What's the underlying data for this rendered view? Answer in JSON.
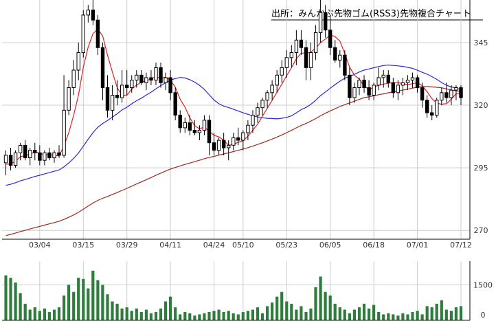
{
  "chart_data": {
    "type": "candlestick",
    "title": "出所：みんかぶ先物ゴム(RSS3)先物複合チャート",
    "x_tick_labels": [
      "03/04",
      "03/15",
      "03/29",
      "04/11",
      "04/24",
      "05/10",
      "05/23",
      "06/05",
      "06/18",
      "07/01",
      "07/12"
    ],
    "price_axis": {
      "ticks": [
        270,
        295,
        320,
        345
      ],
      "ylim": [
        266.5,
        362.0
      ]
    },
    "volume_axis": {
      "ticks": [
        0,
        1500
      ],
      "ylim": [
        0,
        2500
      ]
    },
    "dates": [
      "02/21",
      "02/22",
      "02/26",
      "02/27",
      "02/28",
      "02/29",
      "03/01",
      "03/04",
      "03/05",
      "03/06",
      "03/07",
      "03/08",
      "03/11",
      "03/12",
      "03/13",
      "03/14",
      "03/15",
      "03/18",
      "03/19",
      "03/21",
      "03/22",
      "03/25",
      "03/26",
      "03/27",
      "03/28",
      "03/29",
      "04/01",
      "04/02",
      "04/03",
      "04/04",
      "04/05",
      "04/08",
      "04/09",
      "04/10",
      "04/11",
      "04/12",
      "04/15",
      "04/16",
      "04/17",
      "04/18",
      "04/19",
      "04/22",
      "04/23",
      "04/24",
      "04/25",
      "04/26",
      "05/07",
      "05/08",
      "05/09",
      "05/10",
      "05/13",
      "05/14",
      "05/15",
      "05/16",
      "05/17",
      "05/20",
      "05/21",
      "05/22",
      "05/23",
      "05/24",
      "05/27",
      "05/28",
      "05/29",
      "05/30",
      "05/31",
      "06/03",
      "06/04",
      "06/05",
      "06/06",
      "06/07",
      "06/10",
      "06/11",
      "06/12",
      "06/13",
      "06/14",
      "06/17",
      "06/18",
      "06/19",
      "06/20",
      "06/21",
      "06/24",
      "06/25",
      "06/26",
      "06/27",
      "06/28",
      "07/01",
      "07/02",
      "07/03",
      "07/04",
      "07/05",
      "07/08",
      "07/09",
      "07/10",
      "07/11",
      "07/12"
    ],
    "ohlc": [
      [
        297,
        302,
        292,
        300
      ],
      [
        300,
        303,
        294,
        296
      ],
      [
        296,
        302,
        295,
        301
      ],
      [
        301,
        305,
        298,
        304
      ],
      [
        304,
        306,
        298,
        299
      ],
      [
        299,
        303,
        296,
        302
      ],
      [
        302,
        305,
        298,
        301
      ],
      [
        301,
        304,
        296,
        298
      ],
      [
        298,
        302,
        296,
        301
      ],
      [
        301,
        303,
        298,
        299
      ],
      [
        299,
        302,
        297,
        301
      ],
      [
        301,
        304,
        299,
        300
      ],
      [
        300,
        332,
        299,
        318
      ],
      [
        318,
        330,
        316,
        327
      ],
      [
        327,
        338,
        324,
        334
      ],
      [
        334,
        345,
        330,
        341
      ],
      [
        341,
        358,
        339,
        356
      ],
      [
        356,
        360,
        353,
        358
      ],
      [
        358,
        362,
        352,
        354
      ],
      [
        354,
        356,
        340,
        343
      ],
      [
        343,
        345,
        322,
        327
      ],
      [
        327,
        332,
        315,
        318
      ],
      [
        318,
        328,
        314,
        324
      ],
      [
        324,
        330,
        320,
        323
      ],
      [
        323,
        334,
        321,
        328
      ],
      [
        328,
        334,
        324,
        327
      ],
      [
        327,
        332,
        325,
        330
      ],
      [
        330,
        334,
        327,
        332
      ],
      [
        332,
        334,
        328,
        329
      ],
      [
        329,
        333,
        326,
        331
      ],
      [
        331,
        334,
        328,
        330
      ],
      [
        330,
        337,
        328,
        335
      ],
      [
        335,
        337,
        327,
        329
      ],
      [
        329,
        333,
        326,
        331
      ],
      [
        331,
        334,
        322,
        325
      ],
      [
        325,
        327,
        314,
        316
      ],
      [
        316,
        318,
        309,
        311
      ],
      [
        311,
        315,
        309,
        313
      ],
      [
        313,
        316,
        308,
        310
      ],
      [
        310,
        314,
        308,
        309
      ],
      [
        309,
        312,
        306,
        310
      ],
      [
        310,
        316,
        308,
        314
      ],
      [
        314,
        316,
        300,
        305
      ],
      [
        305,
        309,
        300,
        302
      ],
      [
        302,
        307,
        300,
        306
      ],
      [
        306,
        309,
        300,
        303
      ],
      [
        303,
        306,
        298,
        304
      ],
      [
        304,
        309,
        302,
        307
      ],
      [
        307,
        311,
        304,
        306
      ],
      [
        306,
        310,
        302,
        309
      ],
      [
        309,
        314,
        306,
        312
      ],
      [
        312,
        318,
        309,
        316
      ],
      [
        316,
        321,
        313,
        319
      ],
      [
        319,
        323,
        316,
        322
      ],
      [
        322,
        326,
        319,
        325
      ],
      [
        325,
        330,
        322,
        328
      ],
      [
        328,
        334,
        325,
        332
      ],
      [
        332,
        338,
        329,
        335
      ],
      [
        335,
        342,
        331,
        339
      ],
      [
        339,
        344,
        335,
        341
      ],
      [
        341,
        350,
        336,
        346
      ],
      [
        346,
        350,
        340,
        343
      ],
      [
        343,
        346,
        330,
        335
      ],
      [
        335,
        345,
        330,
        341
      ],
      [
        341,
        352,
        338,
        349
      ],
      [
        349,
        362,
        345,
        357
      ],
      [
        357,
        360,
        347,
        350
      ],
      [
        350,
        356,
        340,
        343
      ],
      [
        343,
        346,
        337,
        338
      ],
      [
        338,
        342,
        335,
        340
      ],
      [
        340,
        342,
        330,
        332
      ],
      [
        332,
        335,
        320,
        323
      ],
      [
        323,
        329,
        321,
        327
      ],
      [
        327,
        331,
        324,
        330
      ],
      [
        330,
        332,
        325,
        327
      ],
      [
        327,
        330,
        322,
        324
      ],
      [
        324,
        329,
        322,
        328
      ],
      [
        328,
        335,
        326,
        331
      ],
      [
        331,
        334,
        327,
        332
      ],
      [
        332,
        334,
        327,
        329
      ],
      [
        329,
        331,
        323,
        325
      ],
      [
        325,
        330,
        322,
        328
      ],
      [
        328,
        331,
        324,
        329
      ],
      [
        329,
        332,
        326,
        330
      ],
      [
        330,
        333,
        327,
        331
      ],
      [
        331,
        332,
        325,
        327
      ],
      [
        327,
        329,
        319,
        322
      ],
      [
        322,
        324,
        315,
        317
      ],
      [
        317,
        320,
        314,
        316
      ],
      [
        316,
        323,
        315,
        322
      ],
      [
        322,
        327,
        320,
        325
      ],
      [
        325,
        329,
        321,
        323
      ],
      [
        323,
        328,
        320,
        326
      ],
      [
        326,
        328,
        322,
        327
      ],
      [
        327,
        328,
        320,
        323
      ]
    ],
    "ma_short_color": "#e0201a",
    "ma_mid_color": "#2a27d8",
    "ma_long_color": "#a0281e",
    "volume": [
      1900,
      1800,
      1600,
      1150,
      700,
      450,
      550,
      400,
      500,
      350,
      450,
      550,
      1050,
      1500,
      1200,
      1800,
      1750,
      1350,
      2100,
      1700,
      1500,
      1100,
      800,
      700,
      500,
      550,
      400,
      500,
      350,
      450,
      300,
      350,
      500,
      800,
      1000,
      550,
      250,
      350,
      300,
      200,
      250,
      300,
      350,
      400,
      450,
      350,
      400,
      300,
      250,
      350,
      400,
      450,
      550,
      300,
      600,
      750,
      1000,
      1200,
      800,
      700,
      450,
      600,
      350,
      500,
      1400,
      1850,
      1200,
      1050,
      700,
      550,
      450,
      300,
      450,
      550,
      700,
      500,
      650,
      350,
      250,
      300,
      250,
      200,
      300,
      250,
      350,
      400,
      250,
      600,
      550,
      700,
      850,
      450,
      400,
      550,
      600
    ],
    "volume_color": "#2e7d3c",
    "grid": true
  }
}
